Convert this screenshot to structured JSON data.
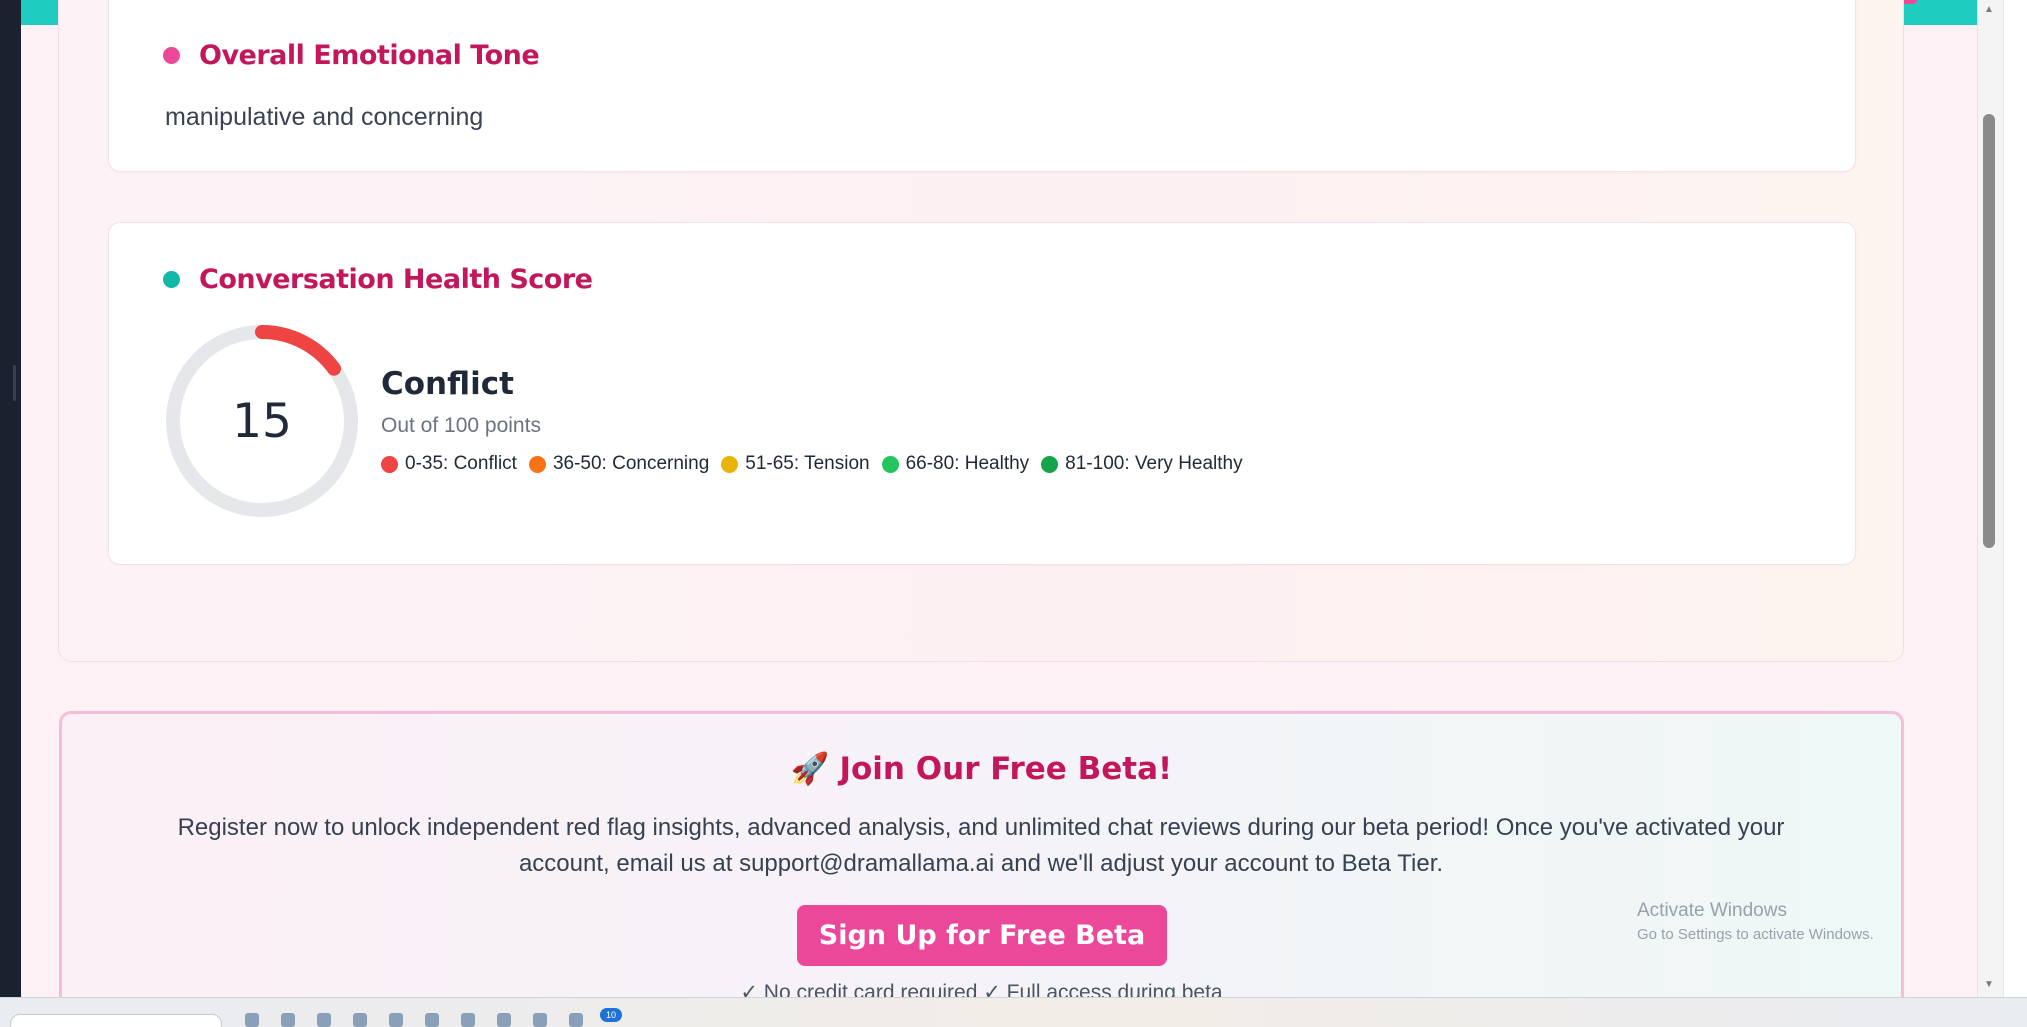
{
  "emotional_tone": {
    "title": "Overall Emotional Tone",
    "value": "manipulative and concerning",
    "dot_color": "#ec4899"
  },
  "health_score": {
    "title": "Conversation Health Score",
    "dot_color": "#14b8a6",
    "score": "15",
    "score_fraction": 0.15,
    "label": "Conflict",
    "subtitle": "Out of 100 points",
    "legend": [
      {
        "label": "0-35: Conflict",
        "color": "#ef4444"
      },
      {
        "label": "36-50: Concerning",
        "color": "#f97316"
      },
      {
        "label": "51-65: Tension",
        "color": "#eab308"
      },
      {
        "label": "66-80: Healthy",
        "color": "#22c55e"
      },
      {
        "label": "81-100: Very Healthy",
        "color": "#16a34a"
      }
    ]
  },
  "beta": {
    "icon": "rocket-icon",
    "icon_glyph": "🚀",
    "title": "Join Our Free Beta!",
    "text": "Register now to unlock independent red flag insights, advanced analysis, and unlimited chat reviews during our beta period! Once you've activated your account, email us at support@dramallama.ai and we'll adjust your account to Beta Tier.",
    "button": "Sign Up for Free Beta",
    "note": "✓ No credit card required ✓ Full access during beta"
  },
  "watermark": {
    "line1": "Activate Windows",
    "line2": "Go to Settings to activate Windows."
  },
  "taskbar": {
    "badge": "10"
  },
  "colors": {
    "accent_teal": "#1ecdc0",
    "accent_pink": "#ec4899",
    "title_magenta": "#c2185b",
    "gauge_track": "#e5e7eb",
    "gauge_fill": "#ef4444"
  }
}
